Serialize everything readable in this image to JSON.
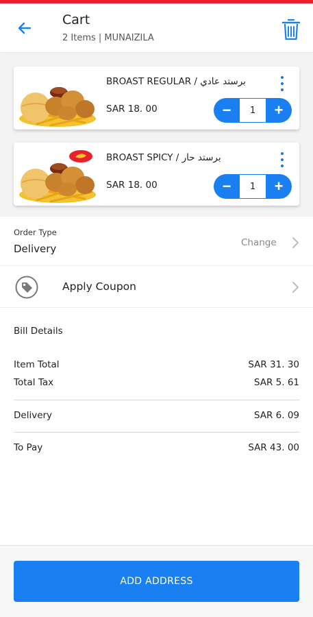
{
  "header": {
    "title": "Cart",
    "subtitle": "2 Items | MUNAIZILA",
    "back_icon": "arrow-left-icon",
    "trash_icon": "trash-icon"
  },
  "colors": {
    "accent": "#1a7ff0",
    "top_stripe": "#e8202a"
  },
  "cart_items": [
    {
      "name": "BROAST REGULAR / برستد عادي",
      "price": "SAR 18. 00",
      "quantity": "1",
      "decrement": "−",
      "increment": "+"
    },
    {
      "name": "BROAST SPICY / برستد حار",
      "price": "SAR 18. 00",
      "quantity": "1",
      "decrement": "−",
      "increment": "+"
    }
  ],
  "order_type": {
    "label": "Order Type",
    "value": "Delivery",
    "change_label": "Change"
  },
  "coupon": {
    "label": "Apply Coupon",
    "icon": "coupon-tag-icon"
  },
  "bill": {
    "title": "Bill Details",
    "rows": [
      {
        "label": "Item Total",
        "value": "SAR 31. 30"
      },
      {
        "label": "Total Tax",
        "value": "SAR 5. 61"
      },
      {
        "label": "Delivery",
        "value": "SAR 6. 09"
      },
      {
        "label": "To Pay",
        "value": "SAR 43. 00"
      }
    ]
  },
  "footer": {
    "button_label": "ADD ADDRESS"
  }
}
